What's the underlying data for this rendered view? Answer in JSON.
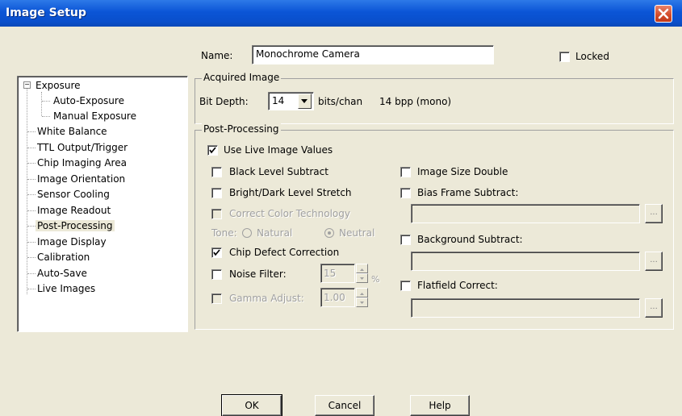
{
  "window": {
    "title": "Image Setup"
  },
  "name_field": {
    "label": "Name:",
    "value": "Monochrome Camera"
  },
  "locked": {
    "label": "Locked",
    "checked": false
  },
  "tree": {
    "items": [
      {
        "label": "Exposure",
        "expanded": true
      },
      {
        "label": "Auto-Exposure"
      },
      {
        "label": "Manual Exposure"
      },
      {
        "label": "White Balance"
      },
      {
        "label": "TTL Output/Trigger"
      },
      {
        "label": "Chip Imaging Area"
      },
      {
        "label": "Image Orientation"
      },
      {
        "label": "Sensor Cooling"
      },
      {
        "label": "Image Readout"
      },
      {
        "label": "Post-Processing",
        "selected": true
      },
      {
        "label": "Image Display"
      },
      {
        "label": "Calibration"
      },
      {
        "label": "Auto-Save"
      },
      {
        "label": "Live Images"
      }
    ]
  },
  "acquired": {
    "group_label": "Acquired Image",
    "bit_depth_label": "Bit Depth:",
    "bit_depth_value": "14",
    "bits_unit": "bits/chan",
    "bpp_text": "14 bpp (mono)"
  },
  "post": {
    "group_label": "Post-Processing",
    "use_live": {
      "label": "Use Live Image Values",
      "checked": true
    },
    "black_level": {
      "label": "Black Level Subtract",
      "checked": false
    },
    "bright_dark": {
      "label": "Bright/Dark Level Stretch",
      "checked": false
    },
    "correct_color": {
      "label": "Correct Color Technology",
      "checked": false
    },
    "tone": {
      "label": "Tone:",
      "natural": "Natural",
      "neutral": "Neutral",
      "selected": "Neutral"
    },
    "chip_defect": {
      "label": "Chip Defect Correction",
      "checked": true
    },
    "noise_filter": {
      "label": "Noise Filter:",
      "value": "15",
      "unit": "%",
      "checked": false
    },
    "gamma": {
      "label": "Gamma Adjust:",
      "value": "1.00",
      "checked": false
    },
    "size_double": {
      "label": "Image Size Double",
      "checked": false
    },
    "bias_frame": {
      "label": "Bias Frame Subtract:",
      "checked": false,
      "browse": "..."
    },
    "background": {
      "label": "Background Subtract:",
      "checked": false,
      "browse": "..."
    },
    "flatfield": {
      "label": "Flatfield Correct:",
      "checked": false,
      "browse": "..."
    }
  },
  "buttons": {
    "ok": "OK",
    "cancel": "Cancel",
    "help": "Help"
  },
  "colors": {
    "titlebar": "#0b55d6",
    "dialog_bg": "#ece9d8",
    "close_red": "#d24a28"
  }
}
